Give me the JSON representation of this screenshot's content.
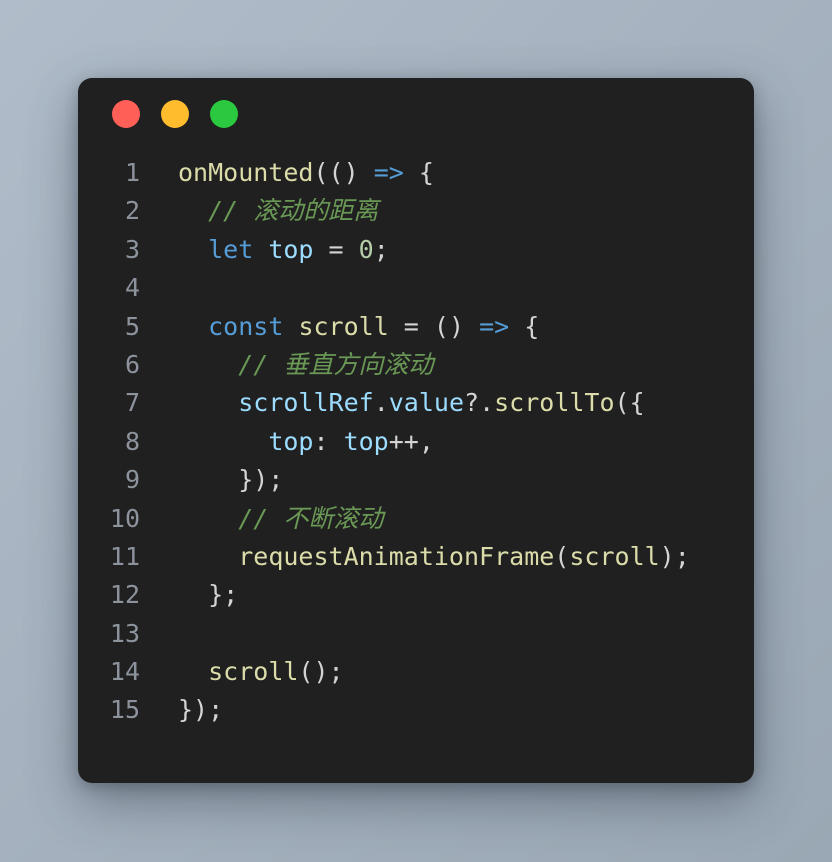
{
  "window": {
    "dots": [
      {
        "name": "close",
        "color": "#ff5f56"
      },
      {
        "name": "minimize",
        "color": "#ffbd2e"
      },
      {
        "name": "zoom",
        "color": "#2bc940"
      }
    ]
  },
  "editor": {
    "language": "javascript",
    "theme": "dark",
    "background": "#202020",
    "line_number_color": "#8d939c",
    "colors": {
      "plain": "#d4d4d4",
      "keyword": "#569cd6",
      "function": "#dcdcaa",
      "variable": "#9cdcfe",
      "number": "#b5cea8",
      "comment": "#6a9955",
      "operator": "#569cd6"
    },
    "plain_text": "onMounted(() => {\n  // 滚动的距离\n  let top = 0;\n\n  const scroll = () => {\n    // 垂直方向滚动\n    scrollRef.value?.scrollTo({\n      top: top++,\n    });\n    // 不断滚动\n    requestAnimationFrame(scroll);\n  };\n\n  scroll();\n});",
    "lines": [
      {
        "number": "1",
        "tokens": [
          {
            "text": "onMounted",
            "type": "func"
          },
          {
            "text": "(() ",
            "type": "punct"
          },
          {
            "text": "=>",
            "type": "operator"
          },
          {
            "text": " {",
            "type": "punct"
          }
        ]
      },
      {
        "number": "2",
        "tokens": [
          {
            "text": "  // 滚动的距离",
            "type": "comment"
          }
        ]
      },
      {
        "number": "3",
        "tokens": [
          {
            "text": "  ",
            "type": "plain"
          },
          {
            "text": "let",
            "type": "keyword"
          },
          {
            "text": " ",
            "type": "plain"
          },
          {
            "text": "top",
            "type": "var"
          },
          {
            "text": " = ",
            "type": "punct"
          },
          {
            "text": "0",
            "type": "number"
          },
          {
            "text": ";",
            "type": "punct"
          }
        ]
      },
      {
        "number": "4",
        "tokens": []
      },
      {
        "number": "5",
        "tokens": [
          {
            "text": "  ",
            "type": "plain"
          },
          {
            "text": "const",
            "type": "keyword"
          },
          {
            "text": " ",
            "type": "plain"
          },
          {
            "text": "scroll",
            "type": "func"
          },
          {
            "text": " = () ",
            "type": "punct"
          },
          {
            "text": "=>",
            "type": "operator"
          },
          {
            "text": " {",
            "type": "punct"
          }
        ]
      },
      {
        "number": "6",
        "tokens": [
          {
            "text": "    // 垂直方向滚动",
            "type": "comment"
          }
        ]
      },
      {
        "number": "7",
        "tokens": [
          {
            "text": "    ",
            "type": "plain"
          },
          {
            "text": "scrollRef",
            "type": "var"
          },
          {
            "text": ".",
            "type": "punct"
          },
          {
            "text": "value",
            "type": "var"
          },
          {
            "text": "?.",
            "type": "punct"
          },
          {
            "text": "scrollTo",
            "type": "func"
          },
          {
            "text": "({",
            "type": "punct"
          }
        ]
      },
      {
        "number": "8",
        "tokens": [
          {
            "text": "      ",
            "type": "plain"
          },
          {
            "text": "top",
            "type": "var"
          },
          {
            "text": ": ",
            "type": "punct"
          },
          {
            "text": "top",
            "type": "var"
          },
          {
            "text": "++,",
            "type": "punct"
          }
        ]
      },
      {
        "number": "9",
        "tokens": [
          {
            "text": "    });",
            "type": "punct"
          }
        ]
      },
      {
        "number": "10",
        "tokens": [
          {
            "text": "    // 不断滚动",
            "type": "comment"
          }
        ]
      },
      {
        "number": "11",
        "tokens": [
          {
            "text": "    ",
            "type": "plain"
          },
          {
            "text": "requestAnimationFrame",
            "type": "func"
          },
          {
            "text": "(",
            "type": "punct"
          },
          {
            "text": "scroll",
            "type": "func"
          },
          {
            "text": ");",
            "type": "punct"
          }
        ]
      },
      {
        "number": "12",
        "tokens": [
          {
            "text": "  };",
            "type": "punct"
          }
        ]
      },
      {
        "number": "13",
        "tokens": []
      },
      {
        "number": "14",
        "tokens": [
          {
            "text": "  ",
            "type": "plain"
          },
          {
            "text": "scroll",
            "type": "func"
          },
          {
            "text": "();",
            "type": "punct"
          }
        ]
      },
      {
        "number": "15",
        "tokens": [
          {
            "text": "});",
            "type": "punct"
          }
        ]
      }
    ]
  }
}
